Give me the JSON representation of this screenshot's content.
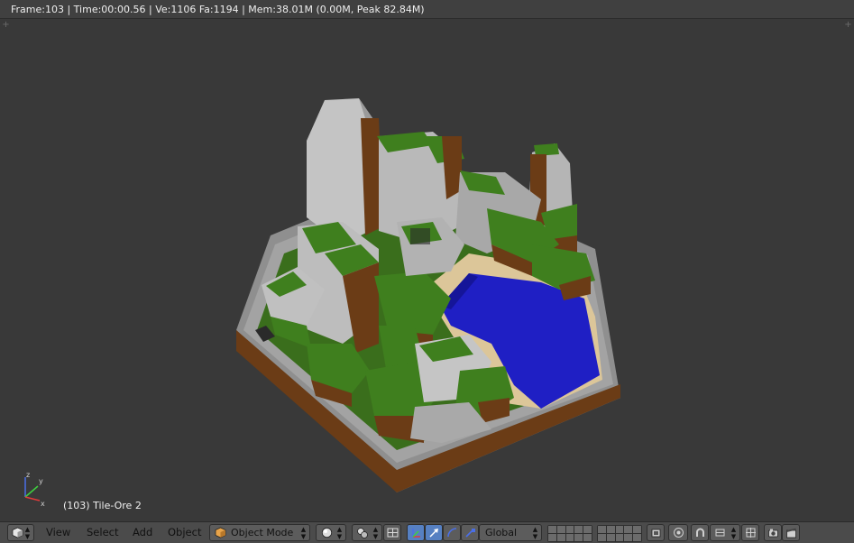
{
  "info_bar": {
    "text": "Frame:103 | Time:00:00.56 | Ve:1106 Fa:1194 | Mem:38.01M (0.00M, Peak 82.84M)"
  },
  "viewport": {
    "object_label": "(103) Tile-Ore 2",
    "axis_labels": {
      "z": "z",
      "y": "y",
      "x": "x"
    }
  },
  "header": {
    "editor_type_icon": "3d-view-cube-icon",
    "menus": [
      "View",
      "Select",
      "Add",
      "Object"
    ],
    "mode": "Object Mode",
    "mode_icon": "object-cube-icon",
    "viewport_shading_icon": "solid-sphere-icon",
    "pivot_icon": "pivot-point-icon",
    "manipulator_icons": [
      "manipulator-toggle-icon",
      "translate-arrow-icon",
      "rotate-arc-icon",
      "scale-icon"
    ],
    "orientation": "Global",
    "right_icons": [
      "layer-grid",
      "layer-grid",
      "render-layers-icon",
      "proportional-edit-icon",
      "snap-magnet-icon",
      "snap-element-icon",
      "snap-target-icon",
      "opengl-render-icon",
      "render-animation-icon"
    ]
  },
  "colors": {
    "viewport_bg": "#393939",
    "header_bg": "#4b4b4b",
    "grass": "#3f7f1e",
    "dirt": "#6b3c16",
    "stone": "#b5b5b5",
    "sand": "#dcc699",
    "water": "#1f1fc4",
    "active_blue": "#5680c2"
  }
}
